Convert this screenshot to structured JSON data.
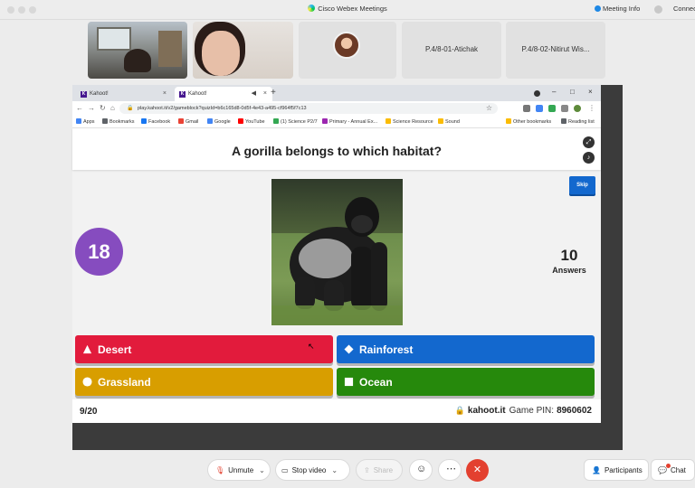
{
  "window": {
    "app_title": "Cisco Webex Meetings",
    "meeting_info": "Meeting Info",
    "connect_label": "Connect"
  },
  "participants": [
    {
      "name": ""
    },
    {
      "name": ""
    },
    {
      "name": ""
    },
    {
      "name": "P.4/8-01-Atichak"
    },
    {
      "name": "P.4/8-02-Nitirut Wis..."
    }
  ],
  "browser": {
    "tabs": [
      {
        "label": "Kahoot!"
      },
      {
        "label": "Kahoot!"
      }
    ],
    "url": "play.kahoot.it/v2/gameblock?quizId=b6c165d8-0d5f-4e43-a495-cf964f5f7c13",
    "bookmarks": [
      "Apps",
      "Bookmarks",
      "Facebook",
      "Gmail",
      "Google",
      "YouTube",
      "(1) Science P2/7",
      "Primary - Annual Ex...",
      "Science Resource",
      "Sound",
      "Other bookmarks",
      "Reading list"
    ],
    "bookmark_colors": [
      "#4285f4",
      "#5f6368",
      "#1877f2",
      "#ea4335",
      "#4285f4",
      "#ff0000",
      "#34a853",
      "#9c27b0",
      "#fbbc04",
      "#fbbc04",
      "#fbbc04",
      "#5f6368"
    ]
  },
  "kahoot": {
    "question": "A gorilla belongs to which habitat?",
    "skip_label": "Skip",
    "timer": "18",
    "answers_count": "10",
    "answers_label": "Answers",
    "answers": [
      {
        "label": "Desert",
        "shape": "triangle-icon",
        "color": "#e21b3c"
      },
      {
        "label": "Rainforest",
        "shape": "diamond-icon",
        "color": "#1368ce"
      },
      {
        "label": "Grassland",
        "shape": "circle-icon",
        "color": "#d89e00"
      },
      {
        "label": "Ocean",
        "shape": "square-icon",
        "color": "#26890c"
      }
    ],
    "progress": "9/20",
    "domain": "kahoot.it",
    "pin_label": "Game PIN:",
    "pin": "8960602"
  },
  "controls": {
    "unmute": "Unmute",
    "stop_video": "Stop video",
    "share": "Share",
    "participants": "Participants",
    "chat": "Chat"
  }
}
